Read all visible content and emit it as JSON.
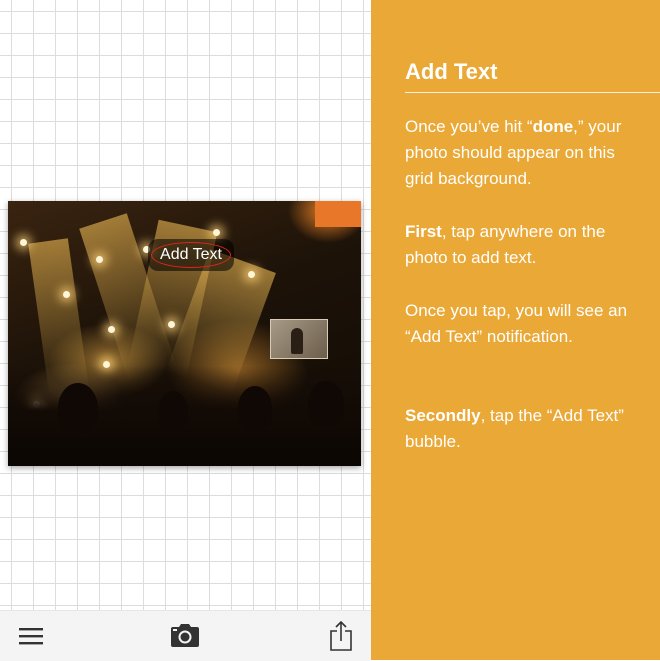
{
  "photo": {
    "bubble_label": "Add Text"
  },
  "toolbar": {
    "menu_icon": "hamburger-menu-icon",
    "camera_icon": "camera-icon",
    "share_icon": "share-icon"
  },
  "panel": {
    "title": "Add Text",
    "p1": {
      "a": "Once you’ve hit “",
      "b": "done",
      "c": ",” your photo should appear on this grid background."
    },
    "p2": {
      "a": "First",
      "b": ", tap anywhere on the photo to add text."
    },
    "p3": {
      "a": "Once you tap, you will see an “Add Text” notification."
    },
    "p4": {
      "a": "Secondly",
      "b": ", tap the “Add Text” bubble."
    }
  },
  "colors": {
    "panel_bg": "#eaa836",
    "highlight_ring": "#e2231a",
    "toolbar_bg": "#f4f4f4"
  }
}
